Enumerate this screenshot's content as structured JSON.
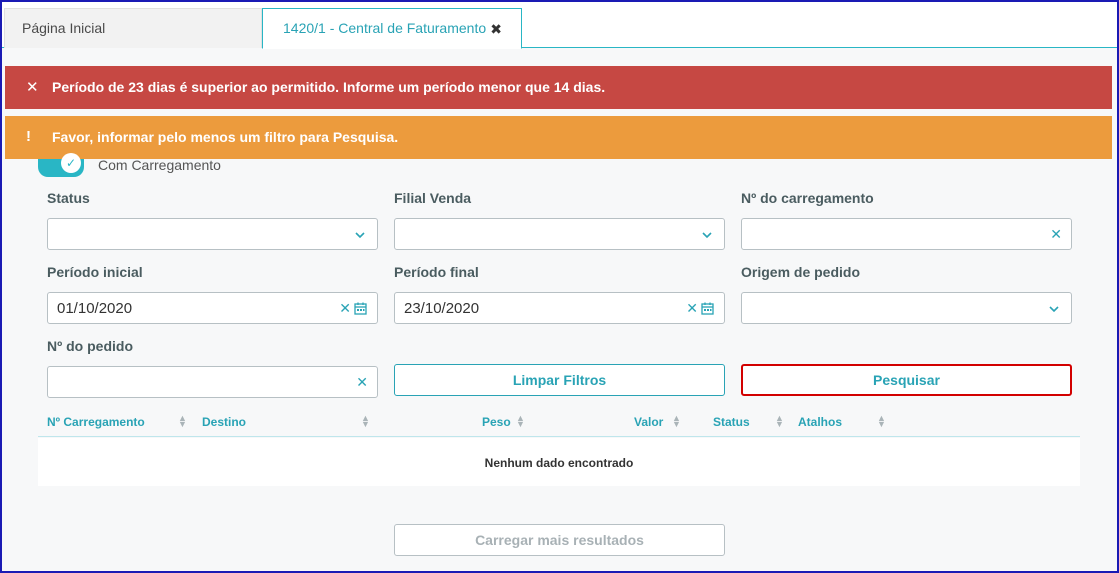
{
  "tabs": {
    "home_label": "Página Inicial",
    "active_label": "1420/1 - Central de Faturamento",
    "close_glyph": "✖"
  },
  "alerts": {
    "danger_icon": "✕",
    "danger_text": "Período de 23 dias é superior ao permitido. Informe um período menor que 14 dias.",
    "warning_icon": "!",
    "warning_text": "Favor, informar pelo menos um filtro para Pesquisa."
  },
  "filters": {
    "toggle_label": "Com Carregamento",
    "status_label": "Status",
    "filial_label": "Filial Venda",
    "carregamento_label": "Nº do carregamento",
    "periodo_inicial_label": "Período inicial",
    "periodo_inicial_value": "01/10/2020",
    "periodo_final_label": "Período final",
    "periodo_final_value": "23/10/2020",
    "origem_label": "Origem de pedido",
    "pedido_label": "Nº do pedido",
    "clear_glyph": "✕",
    "calendar_glyph": "📅"
  },
  "actions": {
    "limpar_label": "Limpar Filtros",
    "pesquisar_label": "Pesquisar",
    "carregar_mais_label": "Carregar mais resultados"
  },
  "table": {
    "columns": [
      "Nº Carregamento",
      "Destino",
      "Peso",
      "Valor",
      "Status",
      "Atalhos"
    ],
    "empty_text": "Nenhum dado encontrado"
  },
  "colors": {
    "accent": "#29a3b5",
    "danger": "#c64843",
    "warning": "#ec9b3d"
  }
}
